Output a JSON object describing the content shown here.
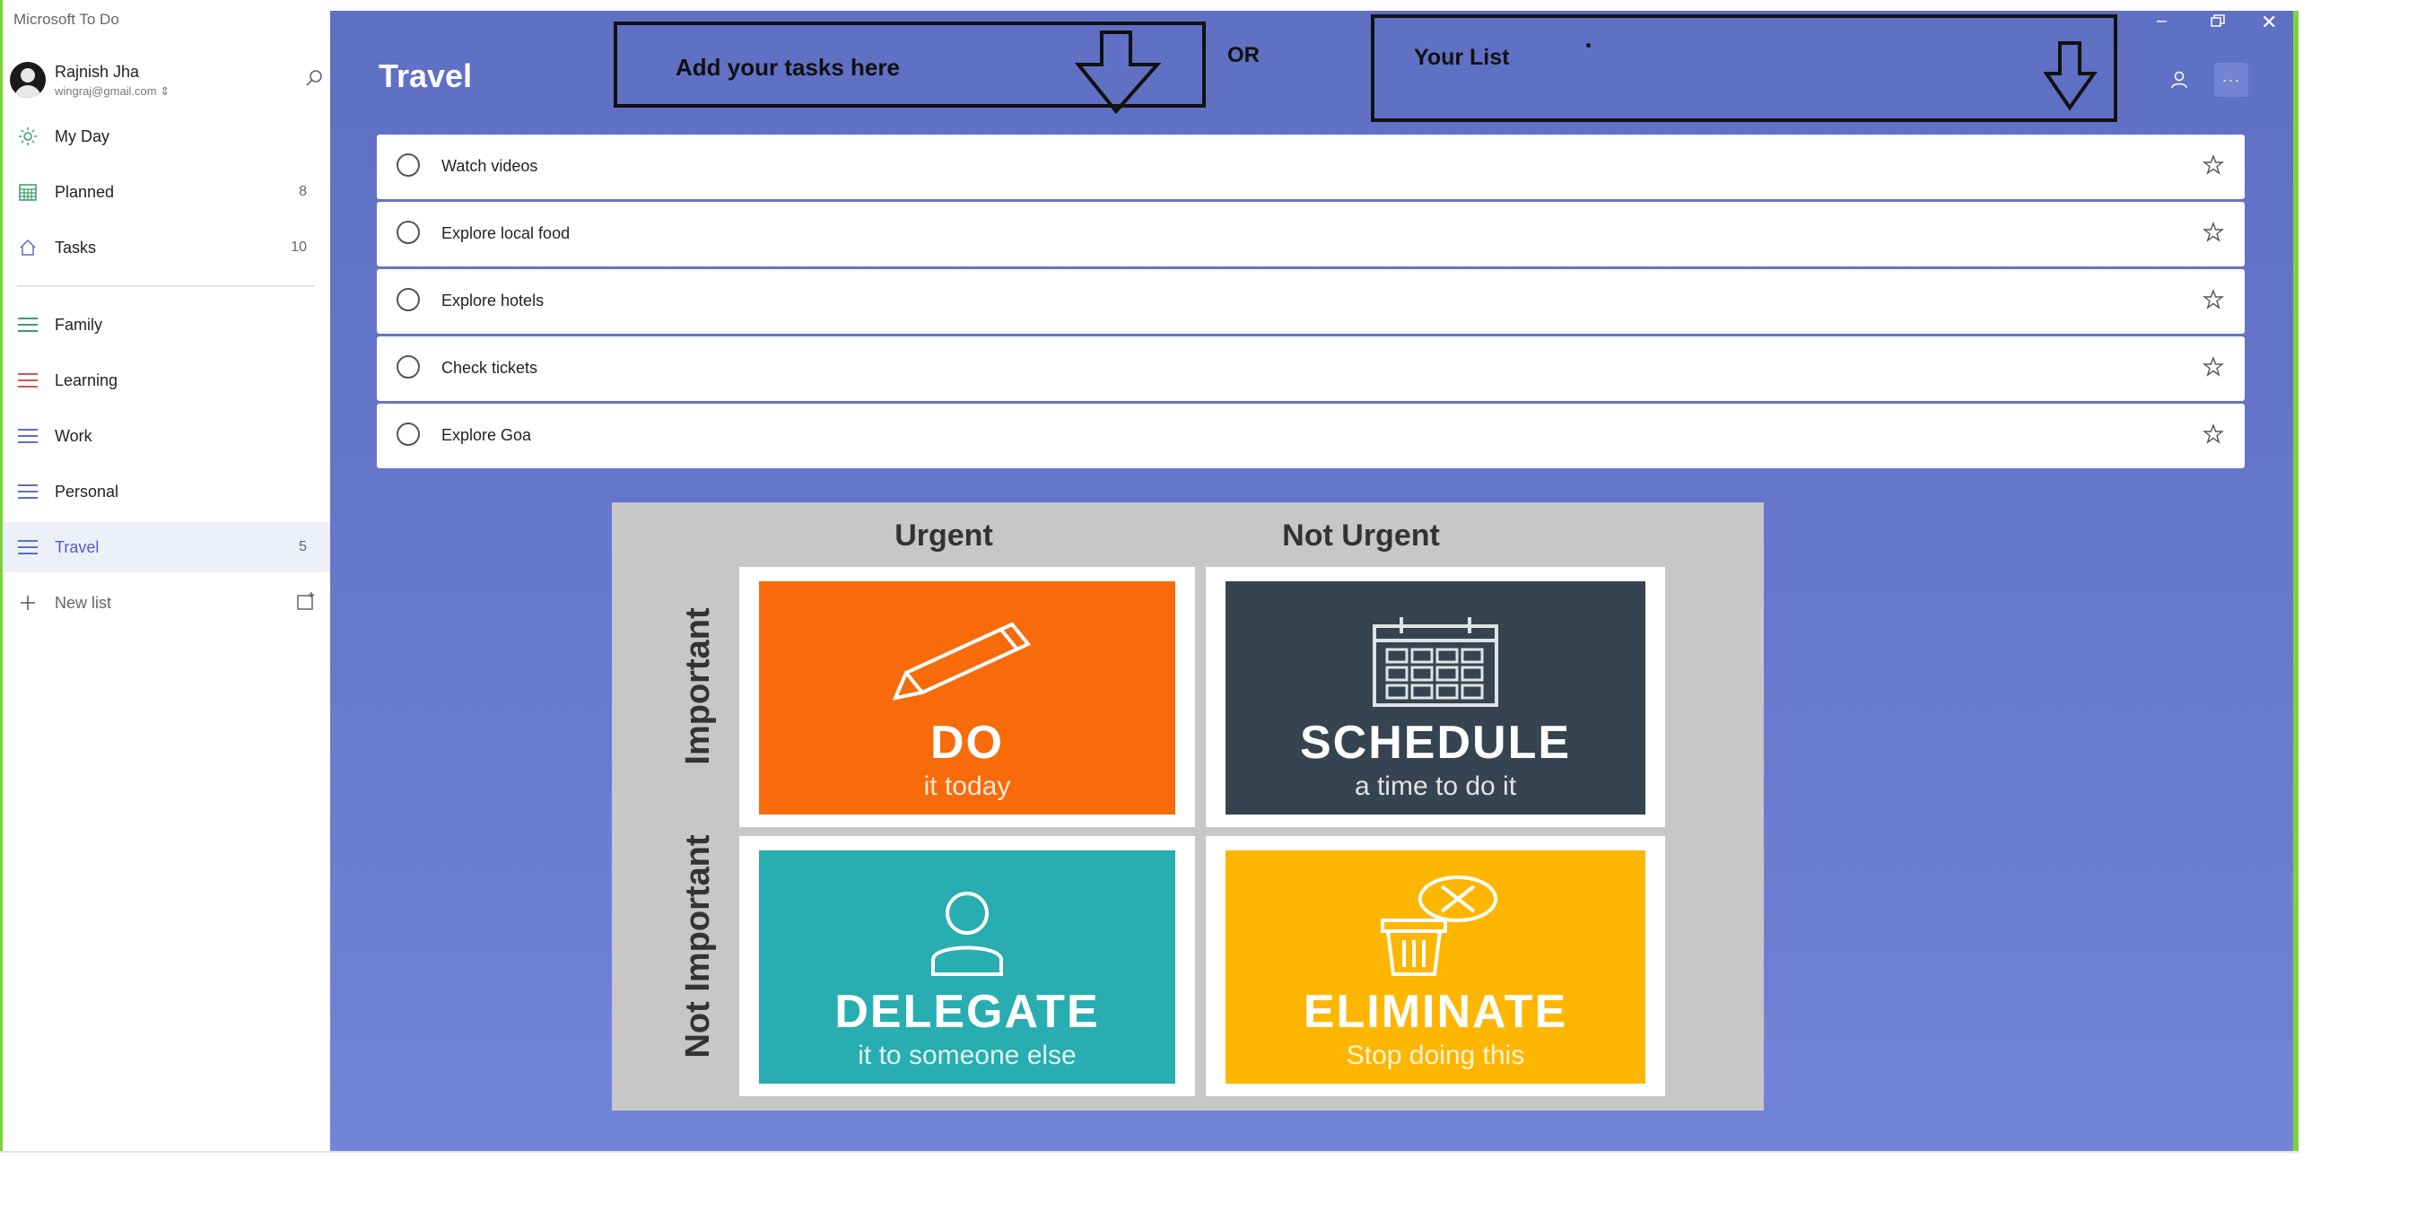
{
  "app": {
    "title": "Microsoft To Do"
  },
  "profile": {
    "name": "Rajnish Jha",
    "email": "wingraj@gmail.com ⇕"
  },
  "sidebar": {
    "smart_lists": [
      {
        "label": "My Day",
        "count": "",
        "icon": "sun-icon"
      },
      {
        "label": "Planned",
        "count": "8",
        "icon": "calendar-icon"
      },
      {
        "label": "Tasks",
        "count": "10",
        "icon": "home-icon"
      }
    ],
    "lists": [
      {
        "label": "Family",
        "count": "",
        "color": "#3a9a6a"
      },
      {
        "label": "Learning",
        "count": "",
        "color": "#d9534f"
      },
      {
        "label": "Work",
        "count": "",
        "color": "#5b6fc7"
      },
      {
        "label": "Personal",
        "count": "",
        "color": "#5b6fc7"
      },
      {
        "label": "Travel",
        "count": "5",
        "color": "#5b6fc7",
        "active": true
      }
    ],
    "new_list_label": "New list"
  },
  "main": {
    "list_title": "Travel",
    "callout_add": "Add your tasks here",
    "or_label": "OR",
    "callout_list": "Your List",
    "tasks": [
      {
        "title": "Watch videos"
      },
      {
        "title": "Explore local food"
      },
      {
        "title": "Explore hotels"
      },
      {
        "title": "Check tickets"
      },
      {
        "title": "Explore Goa"
      }
    ]
  },
  "matrix": {
    "col_headers": [
      "Urgent",
      "Not Urgent"
    ],
    "row_headers": [
      "Important",
      "Not Important"
    ],
    "cells": [
      {
        "title": "DO",
        "subtitle": "it today",
        "color": "#f76b0a",
        "icon": "pencil-icon"
      },
      {
        "title": "SCHEDULE",
        "subtitle": "a time to do it",
        "color": "#364350",
        "icon": "calendar-icon"
      },
      {
        "title": "DELEGATE",
        "subtitle": "it to someone else",
        "color": "#28adb0",
        "icon": "person-icon"
      },
      {
        "title": "ELIMINATE",
        "subtitle": "Stop doing this",
        "color": "#ffb600",
        "icon": "trash-icon"
      }
    ]
  },
  "colors": {
    "accent": "#5f6fc3",
    "window_edge": "#7cd23c"
  }
}
